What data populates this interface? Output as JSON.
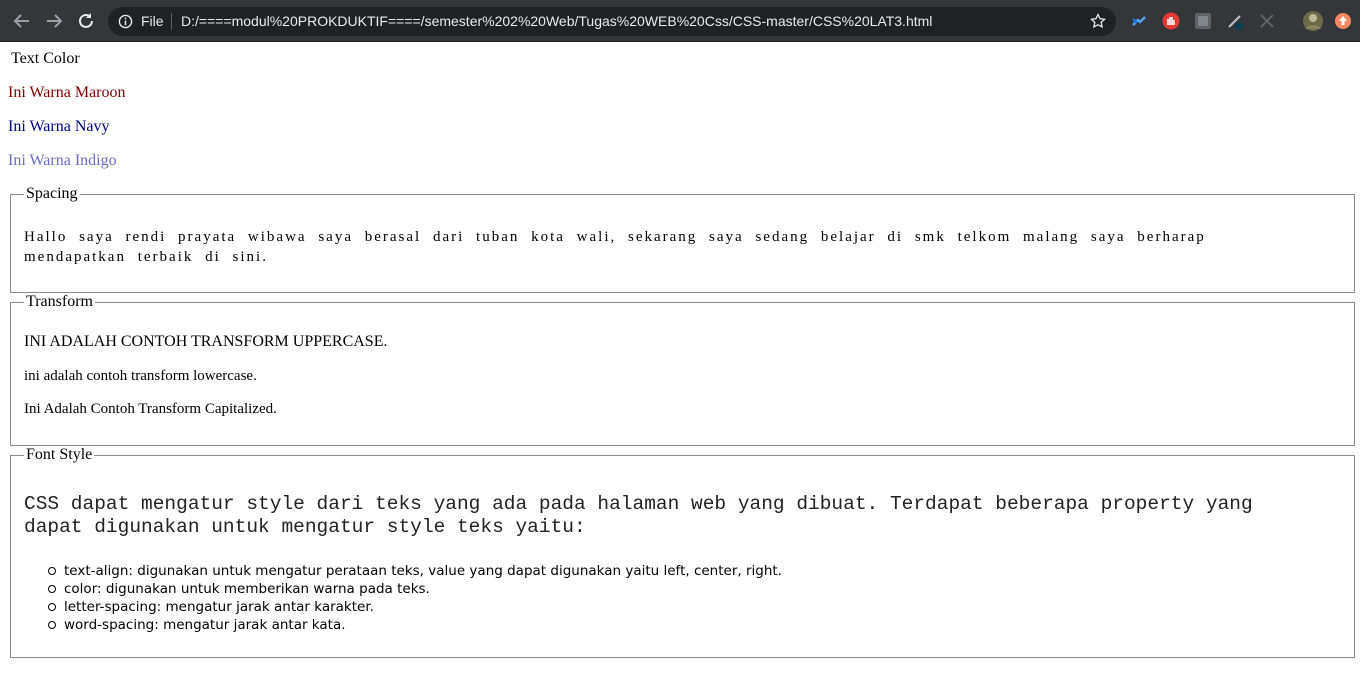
{
  "browser": {
    "scheme_label": "File",
    "url": "D:/====modul%20PROKDUKTIF====/semester%202%20Web/Tugas%20WEB%20Css/CSS-master/CSS%20LAT3.html"
  },
  "page": {
    "heading": "Text Color",
    "colors": [
      {
        "text": "Ini Warna Maroon",
        "color": "#800000"
      },
      {
        "text": "Ini Warna Navy",
        "color": "#000080"
      },
      {
        "text": "Ini Warna Indigo",
        "color": "#6b6bbf"
      }
    ],
    "spacing": {
      "legend": "Spacing",
      "text": "Hallo saya rendi prayata wibawa saya berasal dari tuban kota wali, sekarang saya sedang belajar di smk telkom malang saya berharap mendapatkan terbaik di sini."
    },
    "transform": {
      "legend": "Transform",
      "uppercase": "INI ADALAH CONTOH TRANSFORM UPPERCASE.",
      "lowercase": "ini adalah contoh transform lowercase.",
      "capitalized": "Ini Adalah Contoh Transform Capitalized."
    },
    "font_style": {
      "legend": "Font Style",
      "intro": "CSS dapat mengatur style dari teks yang ada pada halaman web yang dibuat. Terdapat beberapa property yang dapat digunakan untuk mengatur style teks yaitu:",
      "items": [
        "text-align: digunakan untuk mengatur perataan teks, value yang dapat digunakan yaitu left, center, right.",
        "color: digunakan untuk memberikan warna pada teks.",
        "letter-spacing: mengatur jarak antar karakter.",
        "word-spacing: mengatur jarak antar kata."
      ]
    }
  }
}
